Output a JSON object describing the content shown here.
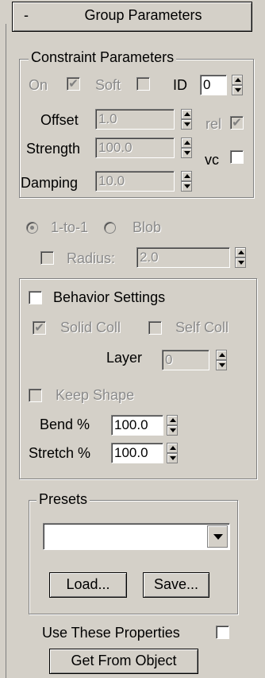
{
  "rollout": {
    "toggle": "-",
    "title": "Group Parameters"
  },
  "constraint": {
    "group_label": "Constraint Parameters",
    "on_label": "On",
    "on_check": "✔",
    "soft_label": "Soft",
    "id_label": "ID",
    "id_value": "0",
    "offset_label": "Offset",
    "offset_value": "1.0",
    "strength_label": "Strength",
    "strength_value": "100.0",
    "damping_label": "Damping",
    "damping_value": "10.0",
    "rel_label": "rel",
    "rel_check": "✔",
    "vc_label": "vc"
  },
  "mode": {
    "one_to_one": "1-to-1",
    "blob": "Blob",
    "radius_label": "Radius:",
    "radius_value": "2.0"
  },
  "behavior": {
    "label": "Behavior Settings",
    "solid_coll_label": "Solid Coll",
    "solid_coll_check": "✔",
    "self_coll_label": "Self Coll",
    "layer_label": "Layer",
    "layer_value": "0",
    "keep_shape_label": "Keep Shape",
    "bend_label": "Bend %",
    "bend_value": "100.0",
    "stretch_label": "Stretch %",
    "stretch_value": "100.0"
  },
  "presets": {
    "group_label": "Presets",
    "dropdown_value": "",
    "load_label": "Load...",
    "save_label": "Save..."
  },
  "footer": {
    "use_props_label": "Use These Properties",
    "get_from_object_label": "Get From Object"
  }
}
